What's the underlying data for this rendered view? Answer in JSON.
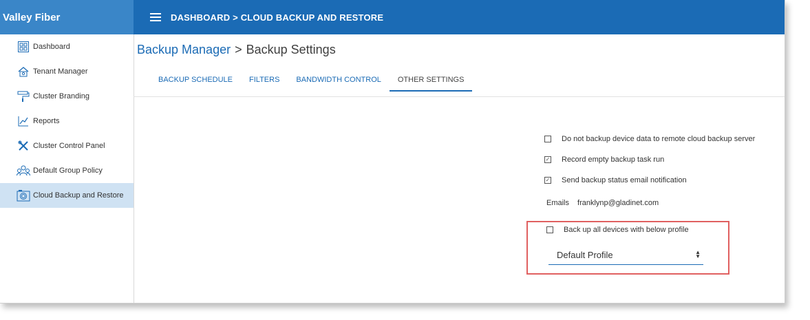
{
  "brand": "Valley Fiber",
  "header": {
    "breadcrumb": "DASHBOARD > CLOUD BACKUP AND RESTORE"
  },
  "sidebar": {
    "items": [
      {
        "label": "Dashboard",
        "icon": "dashboard-icon"
      },
      {
        "label": "Tenant Manager",
        "icon": "tenant-icon"
      },
      {
        "label": "Cluster Branding",
        "icon": "paint-roller-icon"
      },
      {
        "label": "Reports",
        "icon": "chart-icon"
      },
      {
        "label": "Cluster Control Panel",
        "icon": "tools-icon"
      },
      {
        "label": "Default Group Policy",
        "icon": "group-icon"
      },
      {
        "label": "Cloud Backup and Restore",
        "icon": "camera-icon",
        "active": true
      }
    ]
  },
  "page": {
    "title_link": "Backup Manager",
    "title_sep": ">",
    "title_current": "Backup Settings"
  },
  "tabs": [
    {
      "label": "BACKUP SCHEDULE"
    },
    {
      "label": "FILTERS"
    },
    {
      "label": "BANDWIDTH CONTROL"
    },
    {
      "label": "OTHER SETTINGS",
      "active": true
    }
  ],
  "settings": {
    "opt_no_remote": {
      "label": "Do not backup device data to remote cloud backup server",
      "checked": false
    },
    "opt_record_empty": {
      "label": "Record empty backup task run",
      "checked": true
    },
    "opt_send_email": {
      "label": "Send backup status email notification",
      "checked": true
    },
    "emails_label": "Emails",
    "emails_value": "franklynp@gladinet.com",
    "opt_backup_all": {
      "label": "Back up all devices with below profile",
      "checked": false
    },
    "profile_selected": "Default Profile"
  },
  "colors": {
    "header": "#1b6bb5",
    "brand": "#3a86c8",
    "active_item": "#cfe2f3",
    "highlight": "#e06060"
  }
}
